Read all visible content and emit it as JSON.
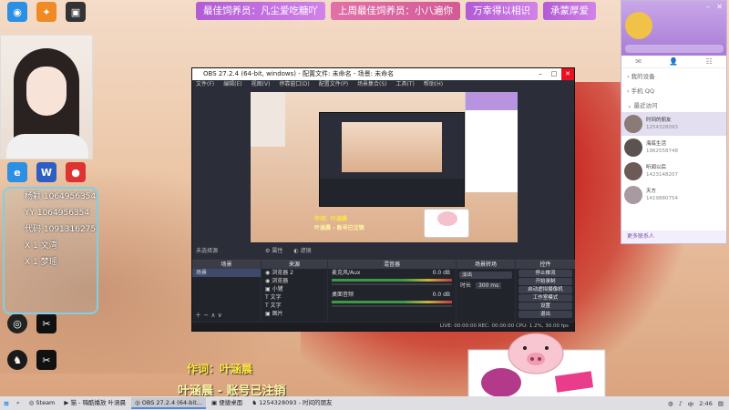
{
  "banner": {
    "items": [
      "最佳饲养员：凡尘爱吃糖吖",
      "上周最佳饲养员：小八遍你",
      "万幸得以相识",
      "承蒙厚爱"
    ]
  },
  "desktop_icons": [
    {
      "icon": "app-icon-blue",
      "label": "",
      "color": "#2b8fe3"
    },
    {
      "icon": "app-icon-orange",
      "label": "",
      "color": "#f08a24"
    },
    {
      "icon": "app-icon-dark",
      "label": "",
      "color": "#333"
    },
    {
      "icon": "browser-icon",
      "label": "",
      "color": "#2b8fe3"
    },
    {
      "icon": "word-icon",
      "label": "",
      "color": "#2f5ec2"
    },
    {
      "icon": "chrome-icon",
      "label": "",
      "color": "#d33"
    }
  ],
  "chat": {
    "lines": [
      "杨颖 1064956354",
      "YY 1064956354",
      "代码 1091316275",
      "",
      "X 1 文湾",
      "X 1 梦瑶",
      ""
    ]
  },
  "obs": {
    "title": "OBS 27.2.4 (64-bit, windows) - 配置文件: 未命名 - 场景: 未命名",
    "menus": [
      "文件(F)",
      "编辑(E)",
      "视图(V)",
      "停靠窗口(D)",
      "配置文件(P)",
      "场景集合(S)",
      "工具(T)",
      "帮助(H)"
    ],
    "preview_overlay_text": [
      "作词：叶涵晨",
      "叶涵晨 - 账号已注销"
    ],
    "info_bar": {
      "label": "未选择源",
      "props_button": "属性",
      "filters_button": "滤镜"
    },
    "scenes": {
      "header": "场景",
      "items": [
        "场景"
      ]
    },
    "sources": {
      "header": "来源",
      "items": [
        "浏览器 2",
        "浏览器",
        "小猪",
        "文字",
        "文字",
        "图片",
        "图片"
      ]
    },
    "mixer": {
      "header": "混音器",
      "channels": [
        {
          "name": "麦克风/Aux",
          "db": "0.0 dB"
        },
        {
          "name": "桌面音频",
          "db": "0.0 dB"
        }
      ]
    },
    "transitions": {
      "header": "场景转场",
      "type": "淡出",
      "duration_label": "时长",
      "duration": "300 ms"
    },
    "controls": {
      "header": "控件",
      "buttons": [
        "停止推流",
        "开始录制",
        "启动虚拟摄像机",
        "工作室模式",
        "设置",
        "退出"
      ]
    },
    "status": "LIVE: 00:00:00  REC: 00:00:00  CPU: 1.2%, 30.00 fps"
  },
  "qq": {
    "name": "",
    "tabs": [
      "chat-bubble-icon",
      "person-icon",
      "group-icon"
    ],
    "sections": [
      "我的设备",
      "手机 QQ",
      "最近访问"
    ],
    "contacts": [
      {
        "name": "时间的朋友",
        "id": "1254328093"
      },
      {
        "name": "海底生活",
        "id": "1962558748"
      },
      {
        "name": "听闻以后",
        "id": "1423148207"
      },
      {
        "name": "天方",
        "id": "1419880754"
      }
    ],
    "bottom_label": "更多联系人"
  },
  "subtitles": {
    "line1": "作词：叶涵晨",
    "line2": "叶涵晨 - 账号已注销"
  },
  "taskbar": {
    "items": [
      {
        "label": "Steam",
        "active": false
      },
      {
        "label": "猫 - 嗨酷播放 叶涵晨",
        "active": false
      },
      {
        "label": "OBS 27.2.4 (64-bit...",
        "active": true
      },
      {
        "label": "便捷桌面",
        "active": false
      },
      {
        "label": "1254328093 - 时间的朋友",
        "active": false
      }
    ],
    "clock": "2:46",
    "lang": "中"
  },
  "colors": {
    "banner_purple": "#b15bd6",
    "banner_pink": "#e171a8",
    "subtitle_yellow": "#ffe83c",
    "obs_bg": "#2b2e38",
    "qq_purple": "#a87bd6"
  }
}
